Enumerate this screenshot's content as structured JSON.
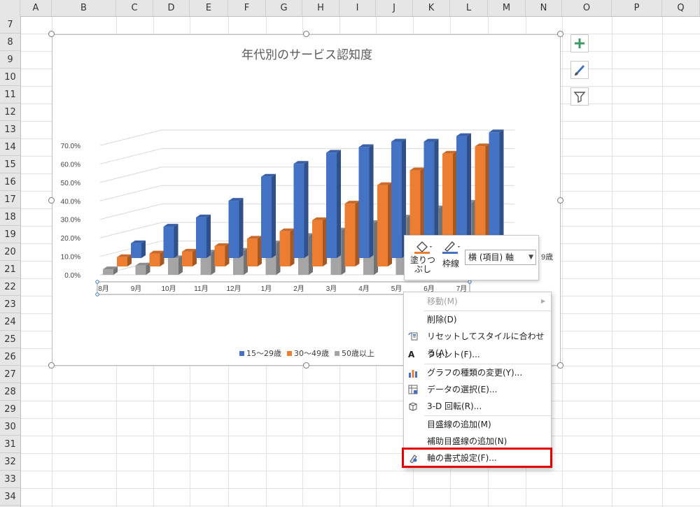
{
  "spreadsheet": {
    "columns": [
      "A",
      "B",
      "C",
      "D",
      "E",
      "F",
      "G",
      "H",
      "I",
      "J",
      "K",
      "L",
      "M",
      "N",
      "O",
      "P",
      "Q"
    ],
    "rows": [
      "7",
      "8",
      "9",
      "10",
      "11",
      "12",
      "13",
      "14",
      "15",
      "16",
      "17",
      "18",
      "19",
      "20",
      "21",
      "22",
      "23",
      "24",
      "25",
      "26",
      "27",
      "28",
      "29",
      "30",
      "31",
      "32",
      "33",
      "34"
    ]
  },
  "chart_data": {
    "type": "bar",
    "title": "年代別のサービス認知度",
    "categories": [
      "8月",
      "9月",
      "10月",
      "11月",
      "12月",
      "1月",
      "2月",
      "3月",
      "4月",
      "5月",
      "6月",
      "7月"
    ],
    "y_ticks": [
      "70.0%",
      "60.0%",
      "50.0%",
      "40.0%",
      "30.0%",
      "20.0%",
      "10.0%",
      "0.0%"
    ],
    "ylim": [
      0,
      70
    ],
    "series": [
      {
        "name": "15〜29歳",
        "color": "#4472c4",
        "values": [
          8,
          17,
          22,
          31,
          44,
          51,
          57,
          60,
          63,
          63,
          66,
          68
        ]
      },
      {
        "name": "30〜49歳",
        "color": "#ed7d31",
        "values": [
          5,
          7,
          8,
          11,
          15,
          19,
          25,
          34,
          44,
          52,
          61,
          65
        ]
      },
      {
        "name": "50歳以上",
        "color": "#a5a5a5",
        "values": [
          3,
          5,
          9,
          12,
          13,
          17,
          21,
          24,
          28,
          31,
          36,
          39
        ]
      }
    ],
    "legend_position": "bottom",
    "partial_label": "9歳"
  },
  "side_buttons": {
    "add_icon": "plus-icon",
    "style_icon": "brush-icon",
    "filter_icon": "filter-icon"
  },
  "minibar": {
    "fill_label_1": "塗りつ",
    "fill_label_2": "ぶし",
    "outline_label": "枠線",
    "element_selector": "横 (項目) 軸"
  },
  "context_menu": {
    "items": [
      {
        "label": "移動(M)",
        "disabled": true,
        "submenu": true
      },
      {
        "label": "削除(D)"
      },
      {
        "label": "リセットしてスタイルに合わせる(A)"
      },
      {
        "label": "フォント(F)..."
      },
      {
        "label": "グラフの種類の変更(Y)..."
      },
      {
        "label": "データの選択(E)..."
      },
      {
        "label": "3-D 回転(R)..."
      },
      {
        "label": "目盛線の追加(M)"
      },
      {
        "label": "補助目盛線の追加(N)"
      },
      {
        "label": "軸の書式設定(F)..."
      }
    ],
    "highlight_color": "#e30000"
  }
}
